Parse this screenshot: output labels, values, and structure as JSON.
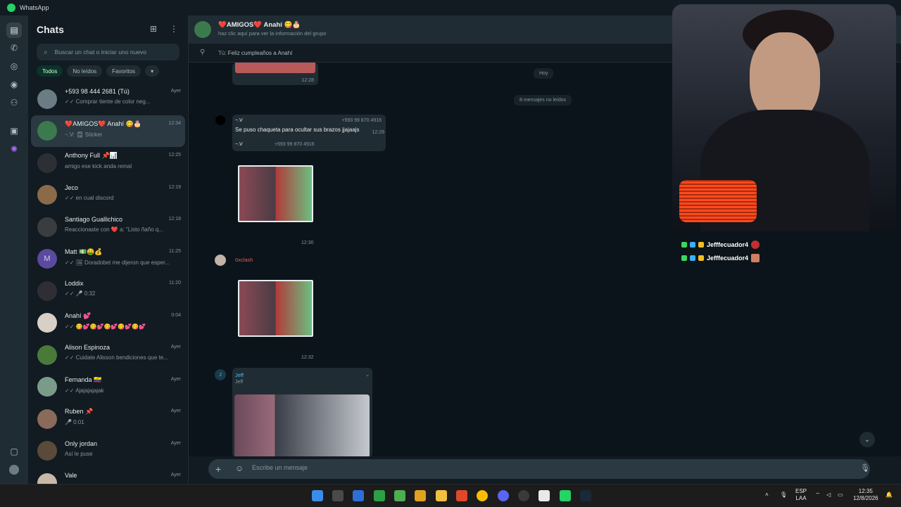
{
  "window": {
    "title": "WhatsApp"
  },
  "sidebar": {
    "title": "Chats",
    "search_placeholder": "Buscar un chat o iniciar uno nuevo",
    "filters": [
      "Todos",
      "No leídos",
      "Favoritos",
      "▾"
    ],
    "chats": [
      {
        "name": "+593 98 444 2681 (Tú)",
        "time": "Ayer",
        "preview": "✓✓ Comprar tiente de color neg..."
      },
      {
        "name": "❤️AMIGOS❤️ Anahí 😋🎂",
        "time": "12:34",
        "preview": "~.V: 🗒 Sticker"
      },
      {
        "name": "Anthony Full 📌📊",
        "time": "12:25",
        "preview": "amigo ese kick anda remal"
      },
      {
        "name": "Jeco",
        "time": "12:19",
        "preview": "✓✓ en cual discord"
      },
      {
        "name": "Santiago Guallichico",
        "time": "12:18",
        "preview": "Reaccionaste con ❤️ a: \"Listo ñaño q..."
      },
      {
        "name": "Matt 💵🤑💰",
        "time": "11:25",
        "preview": "✓✓ 🖼 Doradobet me dijeron que esper..."
      },
      {
        "name": "Loddix",
        "time": "11:20",
        "preview": "✓✓ 🎤 0:32"
      },
      {
        "name": "Anahí 💕",
        "time": "0:04",
        "preview": "✓✓ 😋💕😋💕😋💕😋💕😋💕"
      },
      {
        "name": "Alison Espinoza",
        "time": "Ayer",
        "preview": "✓✓ Cuidate Alisson bendiciones que te..."
      },
      {
        "name": "Fernanda 🇪🇨",
        "time": "Ayer",
        "preview": "✓✓ Ajajajajajak"
      },
      {
        "name": "Ruben 📌",
        "time": "Ayer",
        "preview": "🎤 0:01"
      },
      {
        "name": "Only jordan",
        "time": "Ayer",
        "preview": "Así le puse"
      },
      {
        "name": "Vale",
        "time": "Ayer",
        "preview": ""
      }
    ]
  },
  "header": {
    "name": "❤️AMIGOS❤️ Anahí 😋🎂",
    "subtitle": "haz clic aquí para ver la información del grupo"
  },
  "pinned": {
    "author": "Tú:",
    "text": "Feliz cumpleaños a Anahí"
  },
  "messages": {
    "first_time": "12:28",
    "day_label": "Hoy",
    "unread_label": "8 mensajes no leídos",
    "msg1": {
      "author": "~.V",
      "phone": "+593 99 870 4916",
      "text": "Se puso chaqueta para ocultar sus brazos jjajaajs",
      "time": "12:29"
    },
    "quote": {
      "author": "~.V",
      "phone": "+593 99 870 4916"
    },
    "time2": "12:30",
    "sender3": "0xclash",
    "time3": "12:32",
    "msg4": {
      "author": "Jeff",
      "subtitle": "Jeff",
      "avatar": "J"
    }
  },
  "composer": {
    "placeholder": "Escribe un mensaje"
  },
  "stream_overlay": [
    "Jefffecuador4",
    "Jefffecuador4"
  ],
  "taskbar": {
    "lang": "ESP",
    "layout": "LAA",
    "time": "12:35",
    "date": "12/8/2026"
  },
  "colors": {
    "accent": "#25d366",
    "panel": "#202c33",
    "background": "#0b141a",
    "sender3_color": "#e85a5a",
    "jeff_color": "#53bdeb"
  }
}
